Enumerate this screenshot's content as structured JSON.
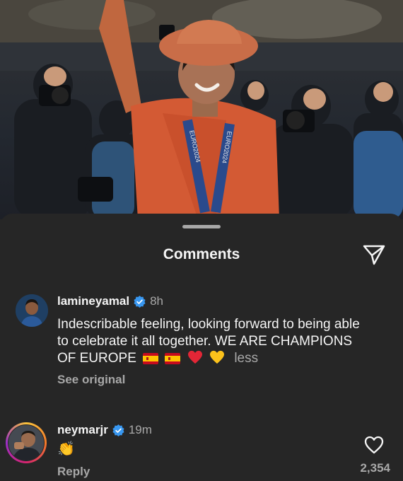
{
  "sheet": {
    "title": "Comments"
  },
  "comments": [
    {
      "username": "lamineyamal",
      "time": "8h",
      "text": "Indescribable feeling, looking forward to being able to celebrate it all together. WE ARE CHAMPIONS OF EUROPE",
      "emojis": [
        "flag-spain",
        "flag-spain",
        "red-heart",
        "yellow-heart"
      ],
      "less_label": "less",
      "see_original_label": "See original"
    },
    {
      "username": "neymarjr",
      "time": "19m",
      "text": "👏",
      "reply_label": "Reply",
      "like_count": "2,354"
    }
  ],
  "photo": {
    "lanyard_text": "EURO2024"
  },
  "colors": {
    "sheet_bg": "#262626",
    "secondary_text": "#a8a8a8",
    "verified_blue": "#3897f0",
    "jersey_orange": "#d35a34"
  }
}
